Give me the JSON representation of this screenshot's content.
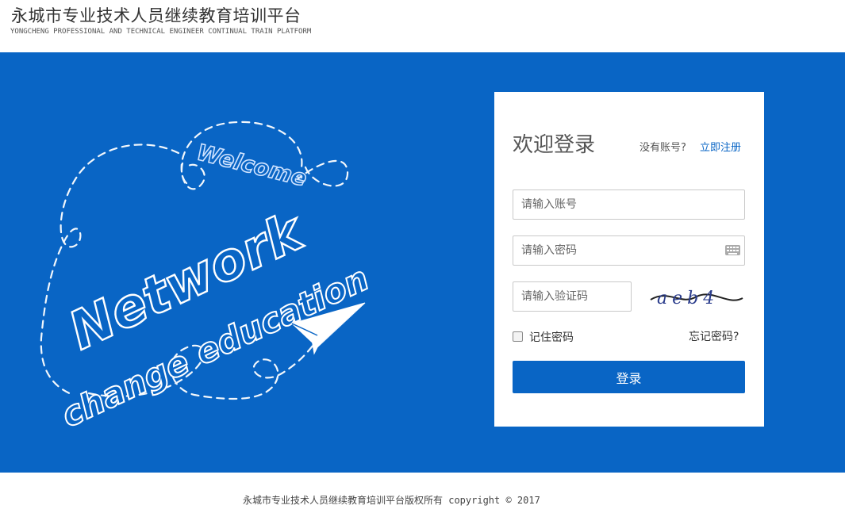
{
  "header": {
    "title": "永城市专业技术人员继续教育培训平台",
    "subtitle": "YONGCHENG PROFESSIONAL AND TECHNICAL ENGINEER CONTINUAL TRAIN PLATFORM"
  },
  "banner": {
    "art_text_1": "Welcome",
    "art_text_2": "Network",
    "art_text_3": "change education",
    "icons": [
      "paper-plane-icon"
    ]
  },
  "login": {
    "welcome": "欢迎登录",
    "no_account": "没有账号?",
    "register_link": "立即注册",
    "account_placeholder": "请输入账号",
    "password_placeholder": "请输入密码",
    "captcha_placeholder": "请输入验证码",
    "captcha_text": "aeb4",
    "remember_label": "记住密码",
    "forgot_label": "忘记密码?",
    "login_button": "登录",
    "icons": [
      "keyboard-icon"
    ]
  },
  "footer": {
    "copyright": "永城市专业技术人员继续教育培训平台版权所有 copyright © 2017"
  },
  "colors": {
    "primary": "#0965c5",
    "background": "#ffffff"
  }
}
